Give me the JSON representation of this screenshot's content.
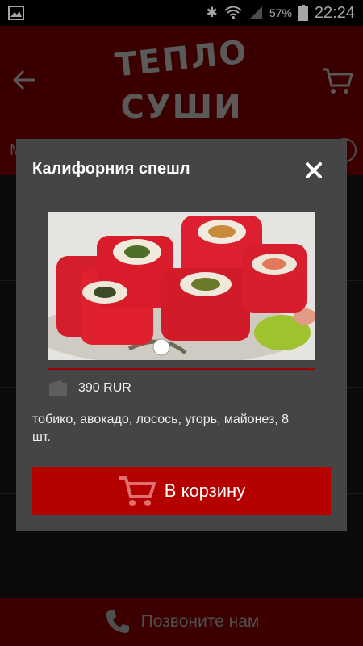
{
  "status_bar": {
    "battery_percent": "57%",
    "time": "22:24"
  },
  "header": {
    "logo_line1": "ТЕПЛО",
    "logo_line2": "СУШИ"
  },
  "subbar": {
    "visible_fragment": "М"
  },
  "bottom_bar": {
    "call_label": "Позвоните нам"
  },
  "dialog": {
    "title": "Калифорния спешл",
    "price": "390 RUR",
    "description": "тобико, авокадо, лосось, угорь, майонез, 8 шт.",
    "add_to_cart_label": "В корзину"
  },
  "colors": {
    "brand_red": "#b50000",
    "header_red_dimmed": "#5c0000",
    "dialog_bg": "#454545"
  }
}
